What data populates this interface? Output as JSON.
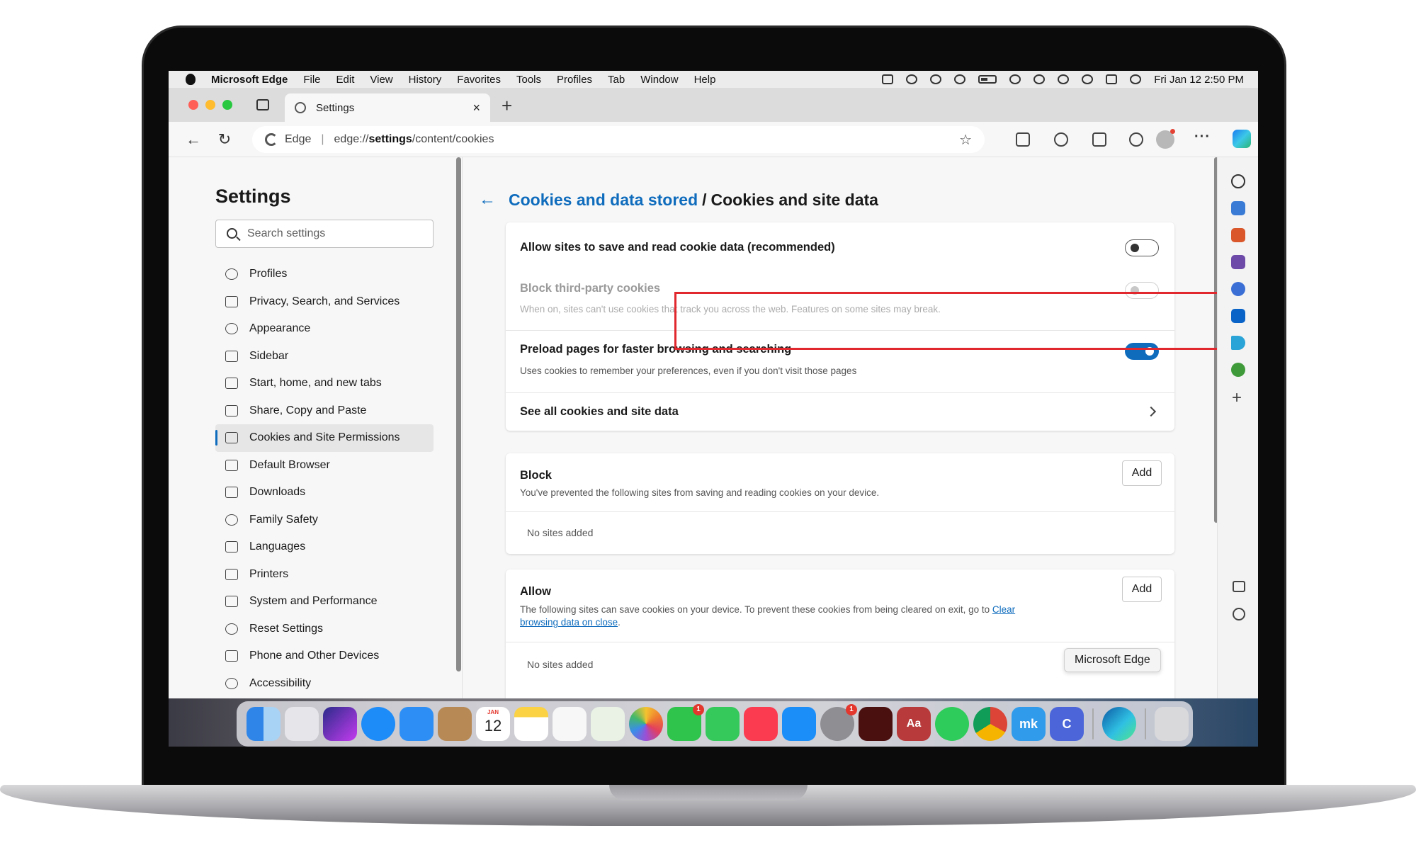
{
  "menubar": {
    "app_name": "Microsoft Edge",
    "menus": [
      "File",
      "Edit",
      "View",
      "History",
      "Favorites",
      "Tools",
      "Profiles",
      "Tab",
      "Window",
      "Help"
    ],
    "clock": "Fri Jan 12  2:50 PM"
  },
  "tab": {
    "title": "Settings",
    "close_glyph": "×",
    "new_glyph": "+"
  },
  "toolbar": {
    "back_glyph": "←",
    "reload_glyph": "↻",
    "address_brand": "Edge",
    "address_separator": "|",
    "url_prefix": "edge://",
    "url_bold": "settings",
    "url_suffix": "/content/cookies",
    "favorite_glyph": "☆",
    "more_glyph": "···"
  },
  "sidebar": {
    "title": "Settings",
    "search_placeholder": "Search settings",
    "items": [
      {
        "label": "Profiles",
        "icon": "profile-icon"
      },
      {
        "label": "Privacy, Search, and Services",
        "icon": "lock-icon"
      },
      {
        "label": "Appearance",
        "icon": "palette-icon"
      },
      {
        "label": "Sidebar",
        "icon": "sidebar-icon"
      },
      {
        "label": "Start, home, and new tabs",
        "icon": "home-tabs-icon"
      },
      {
        "label": "Share, Copy and Paste",
        "icon": "share-icon"
      },
      {
        "label": "Cookies and Site Permissions",
        "icon": "cookies-icon",
        "active": true
      },
      {
        "label": "Default Browser",
        "icon": "browser-icon"
      },
      {
        "label": "Downloads",
        "icon": "download-icon"
      },
      {
        "label": "Family Safety",
        "icon": "family-icon"
      },
      {
        "label": "Languages",
        "icon": "language-icon"
      },
      {
        "label": "Printers",
        "icon": "printer-icon"
      },
      {
        "label": "System and Performance",
        "icon": "laptop-icon"
      },
      {
        "label": "Reset Settings",
        "icon": "reset-icon"
      },
      {
        "label": "Phone and Other Devices",
        "icon": "phone-icon"
      },
      {
        "label": "Accessibility",
        "icon": "accessibility-icon"
      }
    ]
  },
  "main": {
    "back_glyph": "←",
    "breadcrumb_parent": "Cookies and data stored",
    "breadcrumb_separator": "/",
    "breadcrumb_current": "Cookies and site data",
    "allow_cookies": {
      "title": "Allow sites to save and read cookie data (recommended)",
      "enabled": false
    },
    "block_third_party": {
      "title": "Block third-party cookies",
      "desc": "When on, sites can't use cookies that track you across the web. Features on some sites may break.",
      "enabled": false,
      "disabled": true
    },
    "preload": {
      "title": "Preload pages for faster browsing and searching",
      "desc": "Uses cookies to remember your preferences, even if you don't visit those pages",
      "enabled": true
    },
    "see_all": {
      "title": "See all cookies and site data"
    },
    "block": {
      "title": "Block",
      "desc": "You've prevented the following sites from saving and reading cookies on your device.",
      "add_label": "Add",
      "empty": "No sites added"
    },
    "allow": {
      "title": "Allow",
      "desc_before": "The following sites can save cookies on your device. To prevent these cookies from being cleared on exit, go to ",
      "desc_link_1": "Clear",
      "desc_link_2": "browsing data on close",
      "desc_after": ".",
      "add_label": "Add",
      "empty": "No sites added"
    }
  },
  "tooltip": "Microsoft Edge",
  "dock": {
    "calendar_month": "JAN",
    "calendar_day": "12",
    "facetime_badge": "1",
    "settings_badge": "1",
    "dictionary_label": "Aa",
    "mk_label": "mk",
    "c_label": "C"
  },
  "colors": {
    "accent": "#0f6cbd",
    "highlight": "#e0282e",
    "toggle_on": "#0f6cbd"
  }
}
